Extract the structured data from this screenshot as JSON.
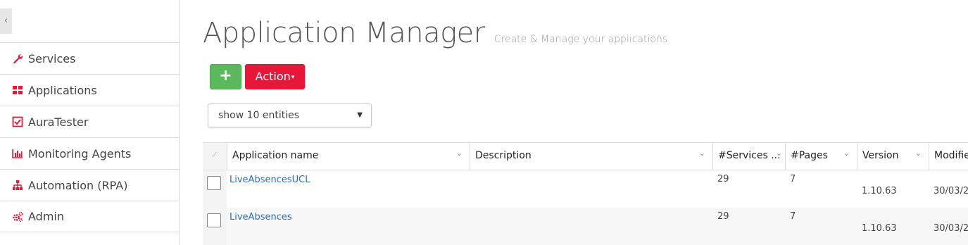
{
  "sidebar": {
    "collapse_glyph": "‹",
    "items": [
      {
        "label": "Services",
        "icon": "wrench-icon"
      },
      {
        "label": "Applications",
        "icon": "th-large-icon"
      },
      {
        "label": "AuraTester",
        "icon": "check-square-icon"
      },
      {
        "label": "Monitoring Agents",
        "icon": "bar-chart-icon"
      },
      {
        "label": "Automation (RPA)",
        "icon": "sitemap-icon"
      },
      {
        "label": "Admin",
        "icon": "cogs-icon"
      }
    ]
  },
  "header": {
    "title": "Application Manager",
    "subtitle": "Create & Manage your applications"
  },
  "toolbar": {
    "add_label": "+",
    "action_label": "Action",
    "action_caret": "▾"
  },
  "entities": {
    "selected": "show 10 entities",
    "caret": "▼"
  },
  "table": {
    "check_glyph": "✓",
    "sort_glyph": "⌄",
    "columns": [
      "Application name",
      "Description",
      "#Services ...",
      "#Pages",
      "Version",
      "Modifie"
    ],
    "rows": [
      {
        "name": "LiveAbsencesUCL",
        "description": "",
        "services": "29",
        "pages": "7",
        "version": "1.10.63",
        "modified": "30/03/2"
      },
      {
        "name": "LiveAbsences",
        "description": "",
        "services": "29",
        "pages": "7",
        "version": "1.10.63",
        "modified": "30/03/2"
      }
    ]
  },
  "colors": {
    "accent_red": "#e8173a",
    "add_green": "#5cb85c",
    "link_blue": "#2a6ebb"
  }
}
